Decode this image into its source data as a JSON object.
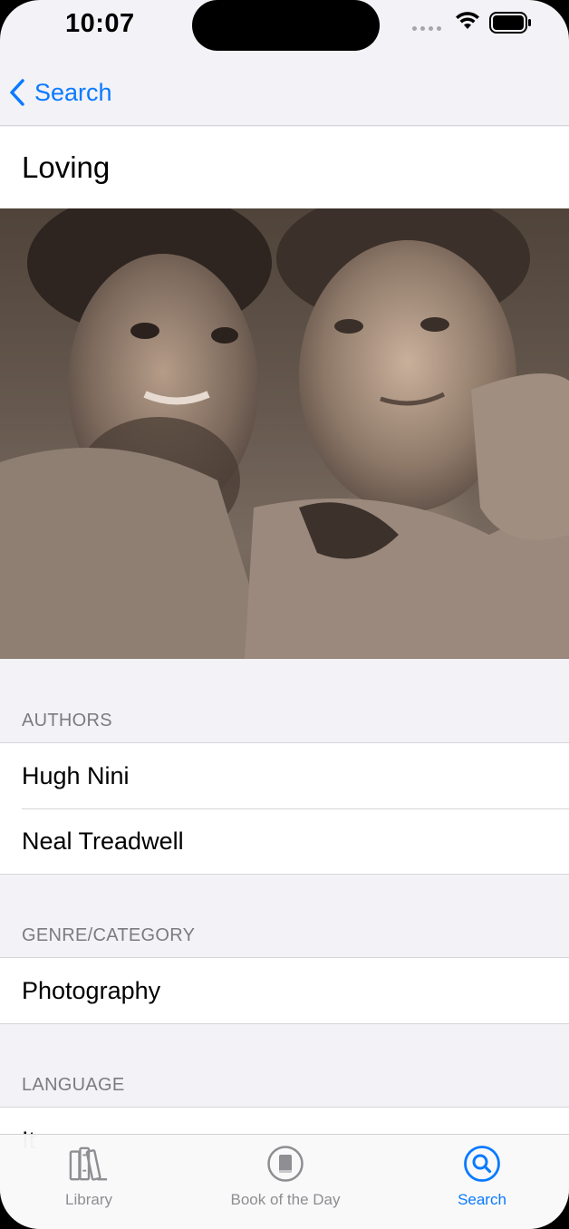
{
  "status_bar": {
    "time": "10:07"
  },
  "nav": {
    "back_label": "Search"
  },
  "book": {
    "title": "Loving"
  },
  "sections": {
    "authors": {
      "header": "AUTHORS",
      "items": [
        "Hugh Nini",
        "Neal Treadwell"
      ]
    },
    "genre": {
      "header": "GENRE/CATEGORY",
      "items": [
        "Photography"
      ]
    },
    "language": {
      "header": "LANGUAGE",
      "items": [
        "It"
      ]
    }
  },
  "tabs": [
    {
      "label": "Library",
      "icon": "books-icon",
      "active": false
    },
    {
      "label": "Book of the Day",
      "icon": "book-circle-icon",
      "active": false
    },
    {
      "label": "Search",
      "icon": "search-circle-icon",
      "active": true
    }
  ],
  "colors": {
    "accent": "#0a7aff",
    "background": "#f2f2f7",
    "inactive_tab": "#8e8e93"
  }
}
